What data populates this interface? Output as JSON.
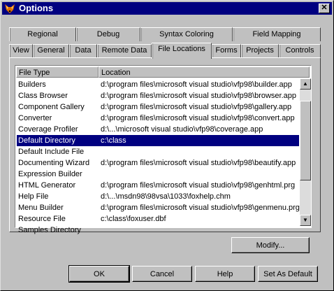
{
  "window": {
    "title": "Options"
  },
  "tabs_row1": [
    {
      "label": "Regional"
    },
    {
      "label": "Debug"
    },
    {
      "label": "Syntax Coloring"
    },
    {
      "label": "Field Mapping"
    }
  ],
  "tabs_row2": [
    {
      "label": "View"
    },
    {
      "label": "General"
    },
    {
      "label": "Data"
    },
    {
      "label": "Remote Data"
    },
    {
      "label": "File Locations"
    },
    {
      "label": "Forms"
    },
    {
      "label": "Projects"
    },
    {
      "label": "Controls"
    }
  ],
  "active_tab": "File Locations",
  "list": {
    "columns": [
      "File Type",
      "Location"
    ],
    "selected": "Default Directory",
    "rows": [
      {
        "type": "Builders",
        "location": "d:\\program files\\microsoft visual studio\\vfp98\\builder.app"
      },
      {
        "type": "Class Browser",
        "location": "d:\\program files\\microsoft visual studio\\vfp98\\browser.app"
      },
      {
        "type": "Component Gallery",
        "location": "d:\\program files\\microsoft visual studio\\vfp98\\gallery.app"
      },
      {
        "type": "Converter",
        "location": "d:\\program files\\microsoft visual studio\\vfp98\\convert.app"
      },
      {
        "type": "Coverage Profiler",
        "location": "d:\\...\\microsoft visual studio\\vfp98\\coverage.app"
      },
      {
        "type": "Default Directory",
        "location": "c:\\class"
      },
      {
        "type": "Default Include File",
        "location": ""
      },
      {
        "type": "Documenting Wizard",
        "location": "d:\\program files\\microsoft visual studio\\vfp98\\beautify.app"
      },
      {
        "type": "Expression Builder",
        "location": ""
      },
      {
        "type": "HTML Generator",
        "location": "d:\\program files\\microsoft visual studio\\vfp98\\genhtml.prg"
      },
      {
        "type": "Help File",
        "location": "d:\\...\\msdn98\\98vsa\\1033\\foxhelp.chm"
      },
      {
        "type": "Menu Builder",
        "location": "d:\\program files\\microsoft visual studio\\vfp98\\genmenu.prg"
      },
      {
        "type": "Resource File",
        "location": "c:\\class\\foxuser.dbf"
      },
      {
        "type": "Samples Directory",
        "location": ""
      }
    ]
  },
  "buttons": {
    "modify": "Modify...",
    "ok": "OK",
    "cancel": "Cancel",
    "help": "Help",
    "set_default": "Set As Default"
  },
  "colors": {
    "titlebar": "#000080",
    "selection": "#000080",
    "face": "#c0c0c0"
  },
  "icons": {
    "app": "fox-icon",
    "close": "close-icon"
  }
}
